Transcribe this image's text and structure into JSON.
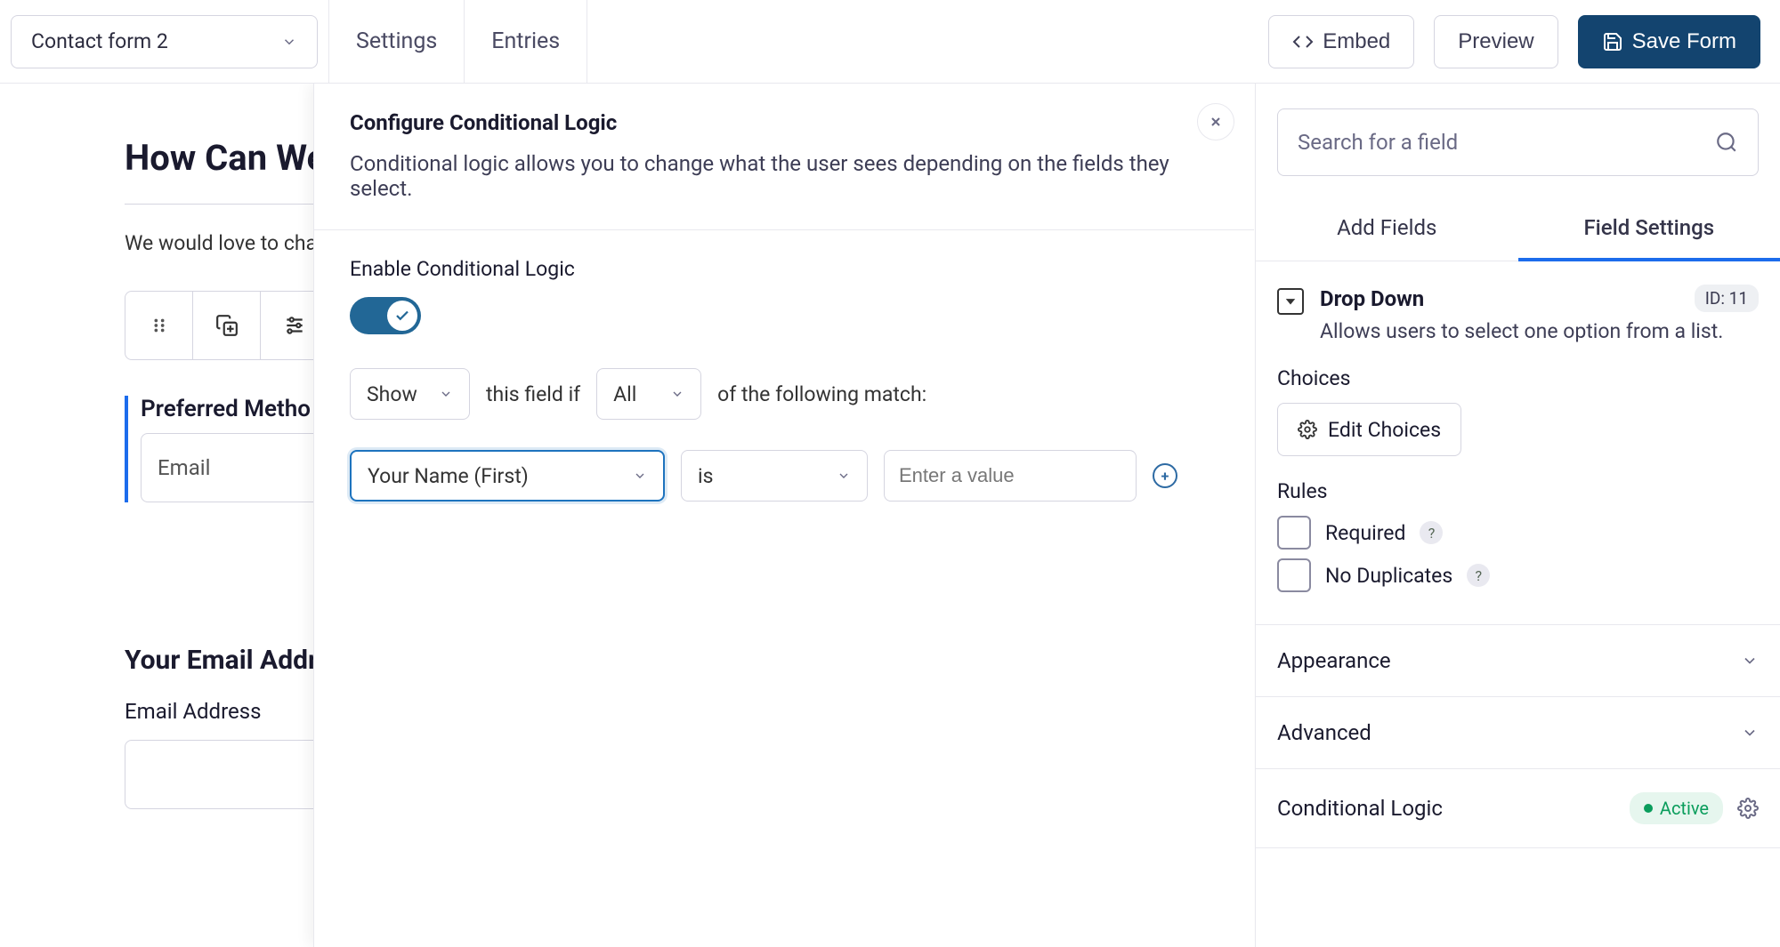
{
  "header": {
    "form_name": "Contact form 2",
    "tab_settings": "Settings",
    "tab_entries": "Entries",
    "embed": "Embed",
    "preview": "Preview",
    "save": "Save Form"
  },
  "canvas": {
    "title": "How Can We",
    "subtitle": "We would love to chat",
    "preferred_label": "Preferred Metho",
    "preferred_value": "Email",
    "email_heading": "Your Email Addre",
    "email_label": "Email Address"
  },
  "panel": {
    "title": "Configure Conditional Logic",
    "description": "Conditional logic allows you to change what the user sees depending on the fields they select.",
    "enable_label": "Enable Conditional Logic",
    "action": "Show",
    "text_if": "this field if",
    "match": "All",
    "text_match": "of the following match:",
    "rule_field": "Your Name (First)",
    "rule_op": "is",
    "rule_value_placeholder": "Enter a value"
  },
  "sidebar": {
    "search_placeholder": "Search for a field",
    "tab_add": "Add Fields",
    "tab_settings": "Field Settings",
    "field_type": "Drop Down",
    "field_desc": "Allows users to select one option from a list.",
    "id_label": "ID: 11",
    "choices_label": "Choices",
    "edit_choices": "Edit Choices",
    "rules_label": "Rules",
    "required": "Required",
    "nodup": "No Duplicates",
    "appearance": "Appearance",
    "advanced": "Advanced",
    "conditional_logic": "Conditional Logic",
    "active": "Active"
  }
}
